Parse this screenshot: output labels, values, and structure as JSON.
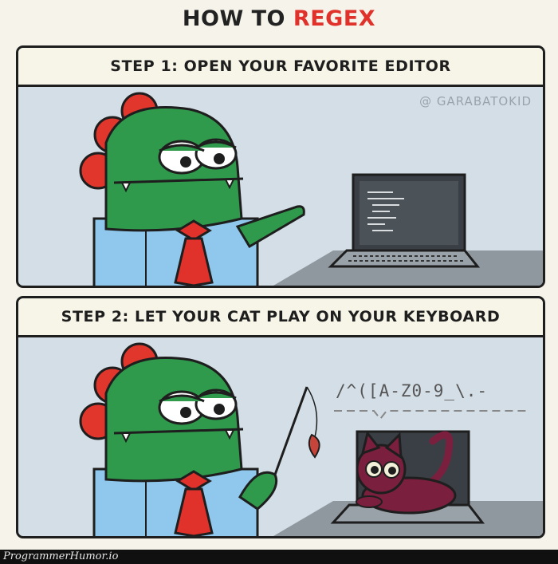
{
  "title": {
    "prefix": "HOW TO",
    "highlight": "REGEX"
  },
  "panels": [
    {
      "header": "STEP 1: OPEN YOUR FAVORITE EDITOR",
      "watermark": "@ GARABATOKID"
    },
    {
      "header": "STEP 2: LET YOUR CAT PLAY ON YOUR KEYBOARD",
      "regex": "/^([A-Z0-9_\\.-"
    }
  ],
  "footer": {
    "site": "ProgrammerHumor.io"
  },
  "colors": {
    "accent": "#e0312b",
    "dino_green": "#2f9a4c",
    "dino_crest": "#e0362c",
    "shirt": "#8fc8ec",
    "tie": "#e0312b",
    "panel_bg": "#d3dee6",
    "cat": "#7a1f3e"
  }
}
